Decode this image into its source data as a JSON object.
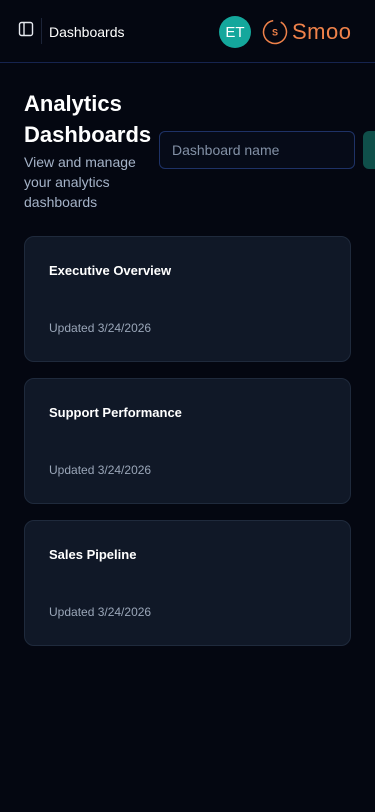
{
  "header": {
    "title": "Dashboards",
    "avatar_initials": "ET",
    "avatar_color": "#14a79c",
    "logo_text": "Smoo",
    "logo_mark": "S",
    "brand_color": "#f0824a"
  },
  "page": {
    "title": "Analytics Dashboards",
    "subtitle": "View and manage your analytics dashboards"
  },
  "search": {
    "placeholder": "Dashboard name",
    "value": ""
  },
  "dashboards": [
    {
      "name": "Executive Overview",
      "updated": "Updated 3/24/2026"
    },
    {
      "name": "Support Performance",
      "updated": "Updated 3/24/2026"
    },
    {
      "name": "Sales Pipeline",
      "updated": "Updated 3/24/2026"
    }
  ]
}
